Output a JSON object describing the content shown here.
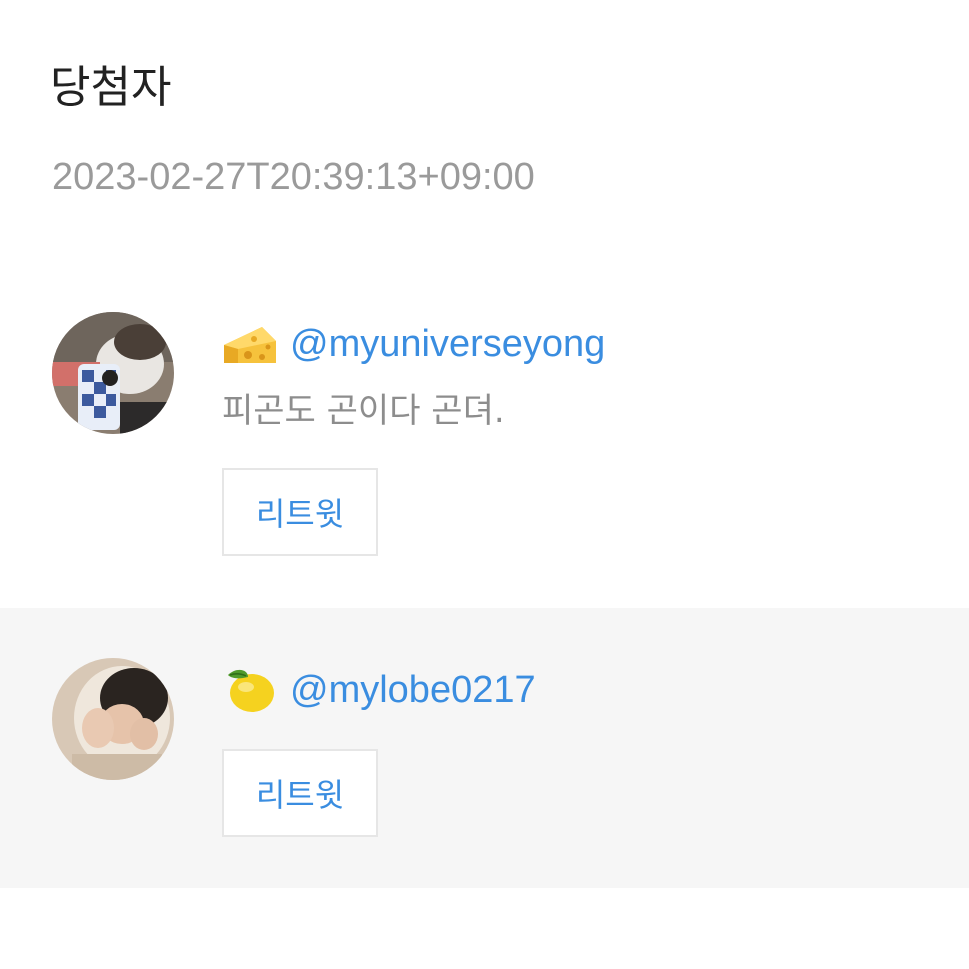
{
  "header": {
    "title": "당첨자",
    "timestamp": "2023-02-27T20:39:13+09:00"
  },
  "winners": [
    {
      "emoji": "cheese-icon",
      "handle": "@myuniverseyong",
      "comment": "피곤도 곤이다 곤뎌.",
      "retweet_label": "리트윗"
    },
    {
      "emoji": "lemon-icon",
      "handle": "@mylobe0217",
      "comment": "",
      "retweet_label": "리트윗"
    }
  ],
  "colors": {
    "accent": "#3a8de0",
    "muted_text": "#9a9a9a",
    "alt_row_bg": "#f6f6f6"
  }
}
